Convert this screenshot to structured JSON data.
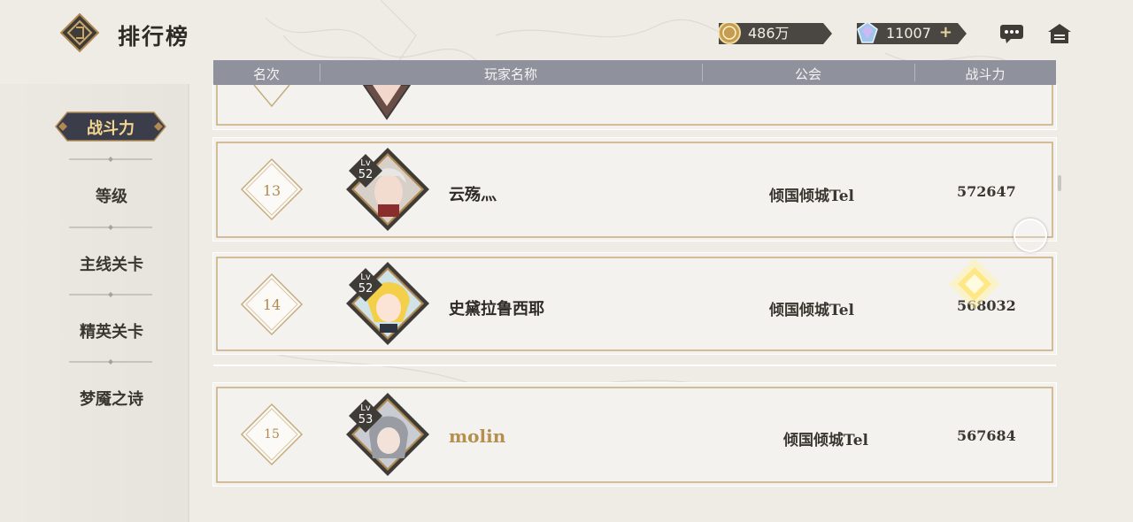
{
  "header": {
    "title": "排行榜",
    "coins": "486万",
    "gems": "11007",
    "gems_add": "+"
  },
  "sidebar": {
    "active": "战斗力",
    "items": [
      {
        "label": "等级"
      },
      {
        "label": "主线关卡"
      },
      {
        "label": "精英关卡"
      },
      {
        "label": "梦魇之诗"
      }
    ]
  },
  "table": {
    "columns": [
      "名次",
      "玩家名称",
      "公会",
      "战斗力"
    ],
    "rows": [
      {
        "rank": "13",
        "lv_label": "Lv",
        "level": "52",
        "name": "云殇灬",
        "guild": "倾国倾城Tel",
        "power": "572647"
      },
      {
        "rank": "14",
        "lv_label": "Lv",
        "level": "52",
        "name": "史黛拉鲁西耶",
        "guild": "倾国倾城Tel",
        "power": "568032"
      },
      {
        "rank": "15",
        "lv_label": "Lv",
        "level": "53",
        "name": "molin",
        "guild": "倾国倾城Tel",
        "power": "567684"
      }
    ]
  },
  "colors": {
    "accent_gold": "#b08a53",
    "header_bar": "#8f929c",
    "badge_dark": "#3f3c38"
  },
  "icons": [
    "logo-icon",
    "coin-icon",
    "gem-icon",
    "chat-icon",
    "home-icon"
  ]
}
